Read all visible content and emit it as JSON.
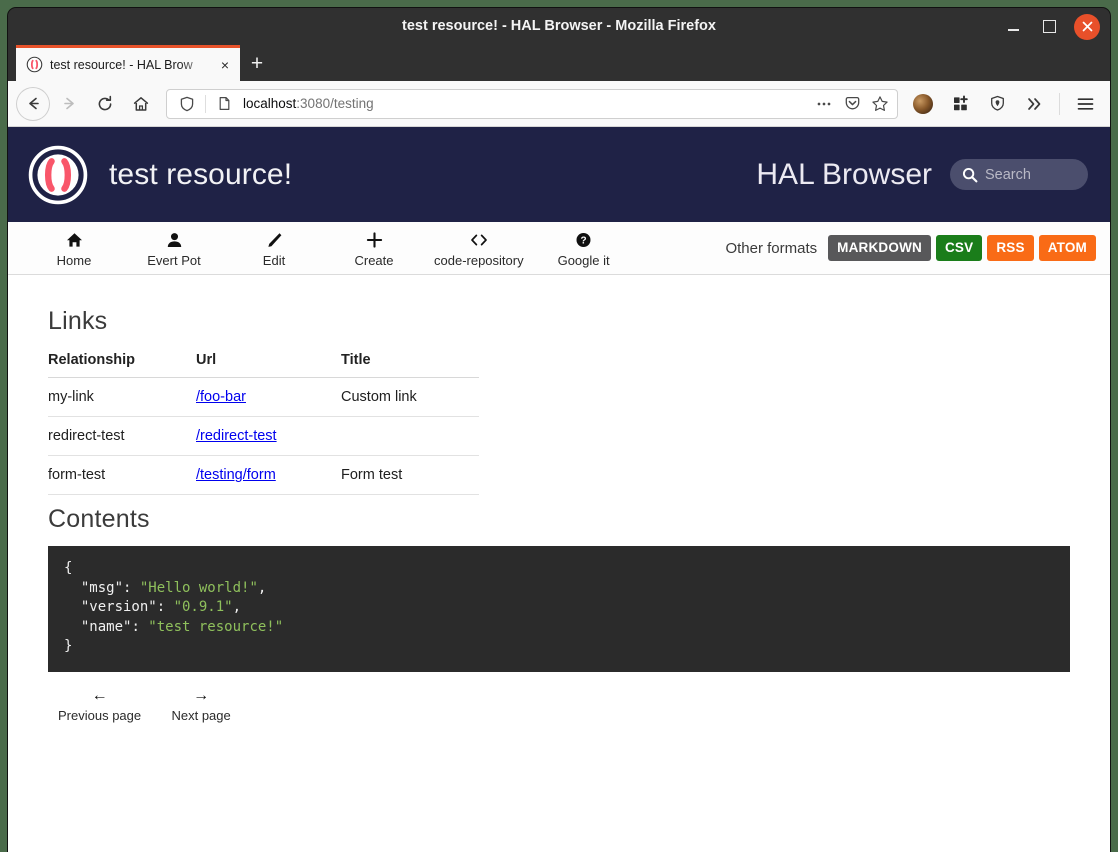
{
  "window": {
    "title": "test resource! - HAL Browser - Mozilla Firefox",
    "minimize_label": "Minimize",
    "maximize_label": "Maximize",
    "close_label": "Close"
  },
  "browser": {
    "tab": {
      "title": "test resource! - HAL Brow",
      "close_label": "×",
      "favicon": "hal-favicon"
    },
    "new_tab_label": "+",
    "nav": {
      "back": "back-arrow-icon",
      "forward": "forward-arrow-icon",
      "reload": "reload-icon",
      "home": "home-icon"
    },
    "url": {
      "host": "localhost",
      "path": ":3080/testing",
      "full": "localhost:3080/testing",
      "shield_icon": "tracking-protection-shield-icon",
      "page_icon": "page-document-icon"
    },
    "url_actions": {
      "more": "…",
      "pocket": "pocket-icon",
      "bookmark": "star-icon"
    },
    "toolbar": {
      "account": "firefox-account-avatar",
      "extensions": "extensions-grid-icon",
      "password_manager": "password-manager-shield-icon",
      "overflow": "»",
      "menu": "hamburger-menu-icon"
    }
  },
  "hal": {
    "brand_title": "test resource!",
    "app_name": "HAL Browser",
    "search": {
      "placeholder": "Search",
      "value": ""
    },
    "nav": [
      {
        "label": "Home",
        "icon": "home-icon"
      },
      {
        "label": "Evert Pot",
        "icon": "person-icon"
      },
      {
        "label": "Edit",
        "icon": "pencil-icon"
      },
      {
        "label": "Create",
        "icon": "plus-icon"
      },
      {
        "label": "code-repository",
        "icon": "code-brackets-icon"
      },
      {
        "label": "Google it",
        "icon": "question-circle-icon"
      }
    ],
    "formats": {
      "label": "Other formats",
      "items": [
        {
          "label": "MARKDOWN",
          "color": "#58585a"
        },
        {
          "label": "CSV",
          "color": "#1a7d1a"
        },
        {
          "label": "RSS",
          "color": "#f96b16"
        },
        {
          "label": "ATOM",
          "color": "#f96b16"
        }
      ]
    },
    "links_section": {
      "heading": "Links",
      "columns": [
        "Relationship",
        "Url",
        "Title"
      ],
      "rows": [
        {
          "relationship": "my-link",
          "url": "/foo-bar",
          "title": "Custom link"
        },
        {
          "relationship": "redirect-test",
          "url": "/redirect-test",
          "title": ""
        },
        {
          "relationship": "form-test",
          "url": "/testing/form",
          "title": "Form test"
        }
      ]
    },
    "contents_section": {
      "heading": "Contents",
      "json": {
        "msg": "Hello world!",
        "version": "0.9.1",
        "name": "test resource!"
      },
      "lines": [
        {
          "text": "{",
          "type": "punct"
        },
        {
          "key": "\"msg\"",
          "value": "\"Hello world!\"",
          "trail": ","
        },
        {
          "key": "\"version\"",
          "value": "\"0.9.1\"",
          "trail": ","
        },
        {
          "key": "\"name\"",
          "value": "\"test resource!\"",
          "trail": ""
        },
        {
          "text": "}",
          "type": "punct"
        }
      ]
    },
    "pager": [
      {
        "label": "Previous page",
        "icon": "arrow-left-icon",
        "glyph": "←"
      },
      {
        "label": "Next page",
        "icon": "arrow-right-icon",
        "glyph": "→"
      }
    ]
  },
  "colors": {
    "header_bg": "#1f2246",
    "logo_accent": "#f9566a",
    "link": "#0000ee",
    "code_bg": "#2b2b2b",
    "code_string": "#8fc05c",
    "tab_accent": "#e8522a",
    "close_button": "#e8502a",
    "desktop": "#4a6b4a"
  }
}
